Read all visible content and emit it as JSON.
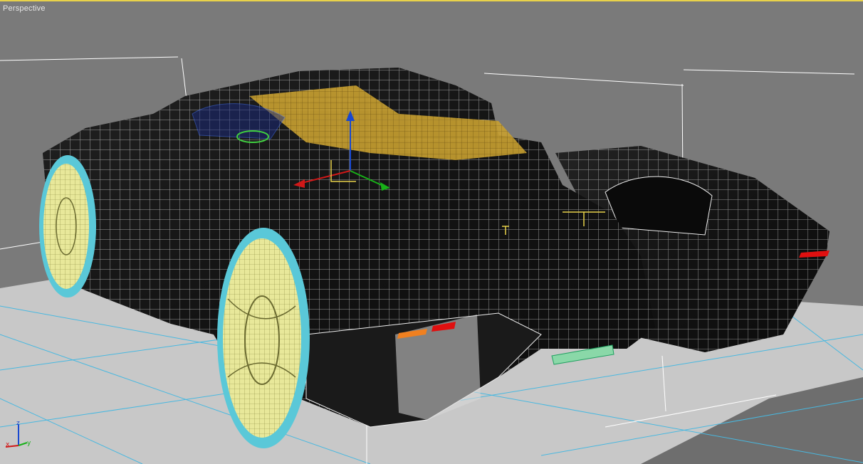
{
  "viewport": {
    "label": "Perspective",
    "active_border_color": "#e8d24a",
    "background_color": "#7a7a7a"
  },
  "scene": {
    "object_icon": "car-wireframe",
    "gizmo_icon": "transform-gizmo-icon"
  },
  "axis_tripod": {
    "x_label": "x",
    "y_label": "y",
    "z_label": "z",
    "colors": {
      "x": "#d01818",
      "y": "#18b018",
      "z": "#1848d0"
    }
  }
}
